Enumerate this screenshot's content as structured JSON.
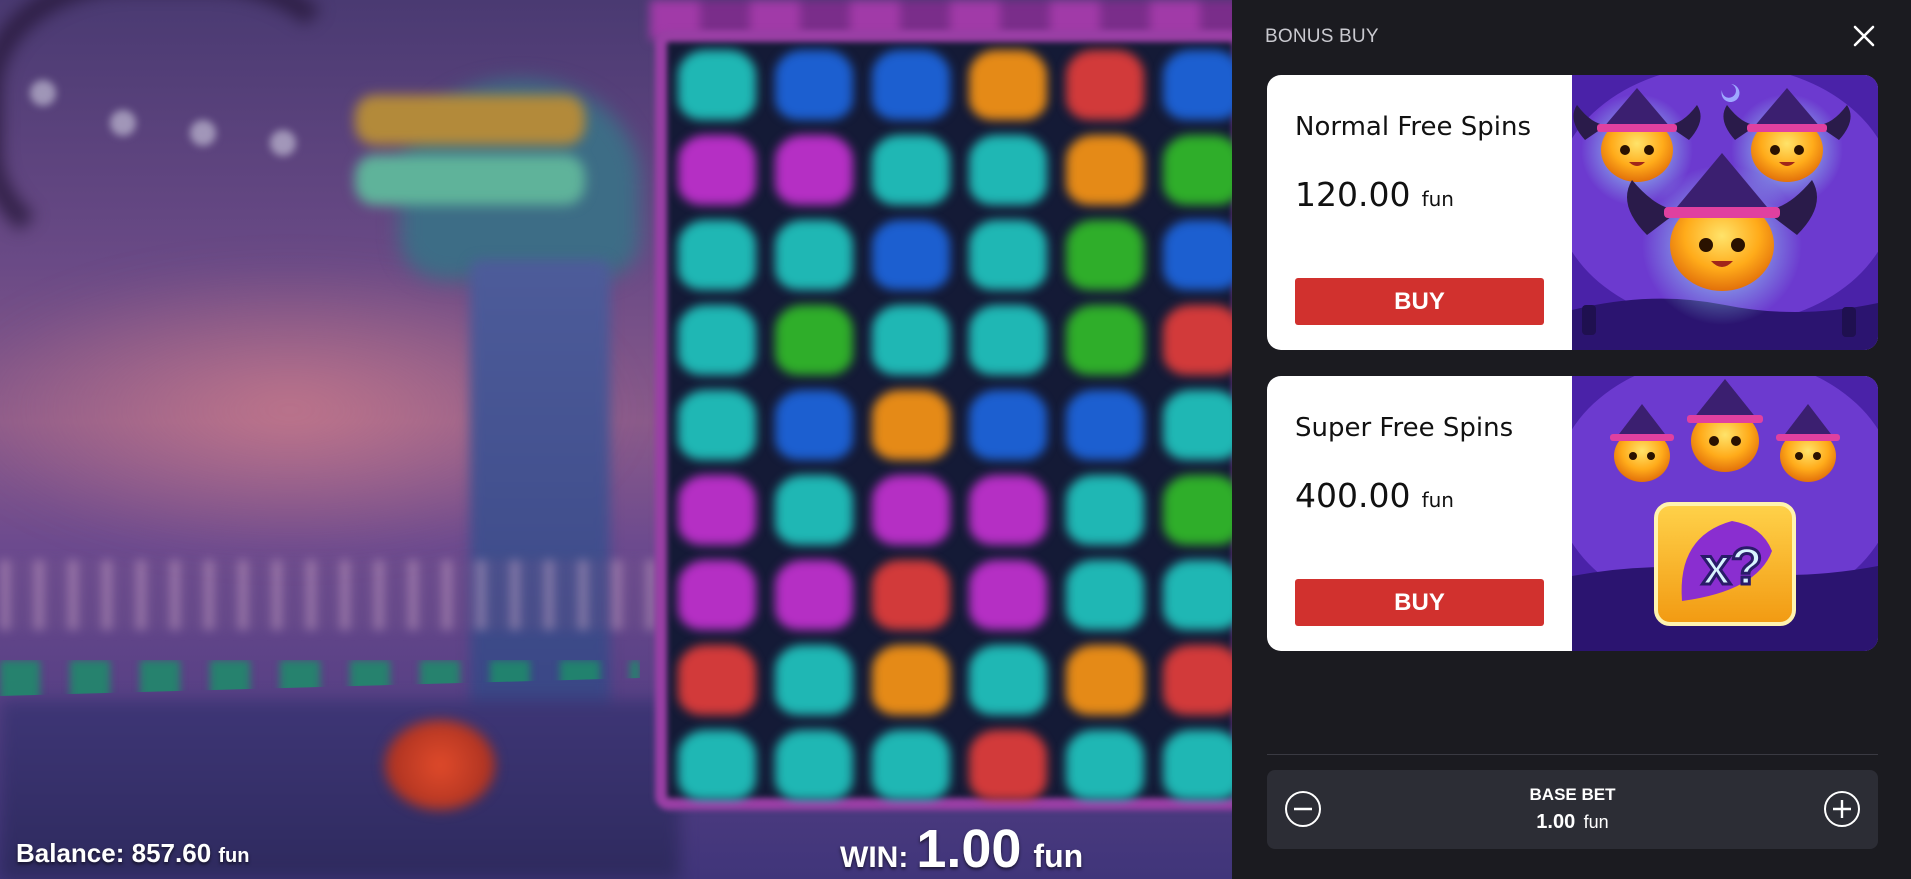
{
  "hud": {
    "balance_label": "Balance:",
    "balance_value": "857.60",
    "balance_unit": "fun",
    "win_label": "WIN:",
    "win_value": "1.00",
    "win_unit": "fun"
  },
  "bonus_buy": {
    "title": "BONUS BUY",
    "close_icon": "close-icon",
    "options": [
      {
        "name": "Normal Free Spins",
        "price": "120.00",
        "unit": "fun",
        "buy_label": "BUY"
      },
      {
        "name": "Super Free Spins",
        "price": "400.00",
        "unit": "fun",
        "buy_label": "BUY"
      }
    ],
    "base_bet": {
      "label": "BASE BET",
      "value": "1.00",
      "unit": "fun",
      "decrease_icon": "minus-circle-icon",
      "increase_icon": "plus-circle-icon"
    }
  },
  "colors": {
    "panel_bg": "#1b1b20",
    "buy_button": "#d1312e",
    "bet_box": "#2c2d35"
  }
}
